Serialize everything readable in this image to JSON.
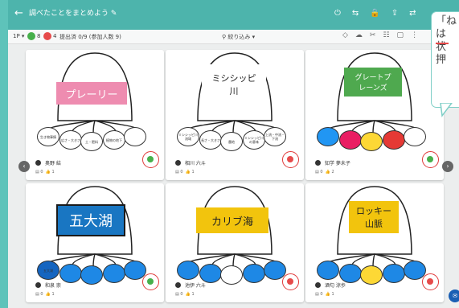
{
  "topbar": {
    "back_icon": "arrow-left-icon",
    "title": "調べたことをまとめよう ✎",
    "icons": [
      "⏻",
      "⇆",
      "🔒",
      "⇪",
      "⇄"
    ]
  },
  "subbar": {
    "page": "1P ▾",
    "green_count": "8",
    "red_count": "4",
    "status": "提出済 0/9 (参加人数 9)",
    "filter": "⚲ 絞り込み ▾",
    "icons": [
      "◇",
      "☁",
      "✂",
      "☷",
      "▢",
      "⋮"
    ]
  },
  "colors": {
    "green": "#47b04b",
    "red": "#e64a4a",
    "accent": "#e03a3a",
    "bar": "#4db4ac"
  },
  "cards": [
    {
      "main": "プレーリー",
      "author": "奥野 結",
      "likes": "1",
      "comments": "0",
      "status": "green",
      "nodes": [
        "生き物事情",
        "広さ・大きさ",
        "土・肥料",
        "植物の地下",
        ""
      ]
    },
    {
      "main": "ミシシッピ\n川",
      "author": "相川 六斗",
      "likes": "1",
      "comments": "0",
      "status": "red",
      "nodes": [
        "ミシシッピ川流域",
        "長さ・大きさ",
        "農地",
        "ミシシッピ川の意味",
        "上流・中流・下流"
      ]
    },
    {
      "main": "グレートプ\nレーンズ",
      "author": "知学 夢未子",
      "likes": "2",
      "comments": "0",
      "status": "green",
      "nodes": [
        "",
        "",
        "",
        "",
        ""
      ]
    },
    {
      "main": "五大湖",
      "author": "和泉 崇",
      "likes": "1",
      "comments": "0",
      "status": "green",
      "nodes": [
        "五大湖",
        "",
        "",
        "",
        ""
      ]
    },
    {
      "main": "カリブ海",
      "author": "池伊 六斗",
      "likes": "1",
      "comments": "0",
      "status": "red",
      "nodes": [
        "",
        "",
        "",
        "",
        ""
      ]
    },
    {
      "main": "ロッキー\n山脈",
      "author": "酒匂 涼歩",
      "likes": "1",
      "comments": "0",
      "status": "red",
      "nodes": [
        "",
        "",
        "",
        "",
        ""
      ]
    }
  ],
  "nav": {
    "prev": "‹",
    "next": "›"
  },
  "callout": {
    "text": "「ね\nは\n状\n押"
  },
  "fab_icon": "chat-icon"
}
